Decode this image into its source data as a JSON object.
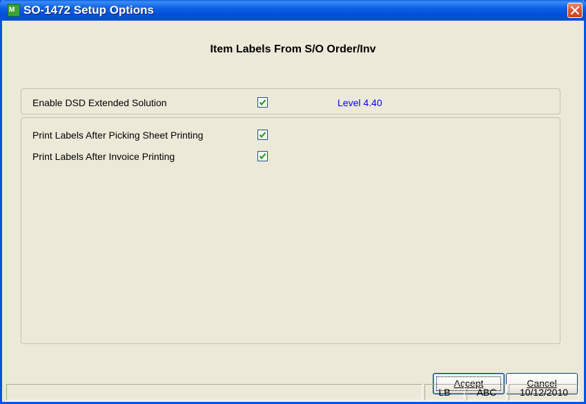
{
  "window": {
    "title": "SO-1472 Setup Options",
    "app_icon_text": "M"
  },
  "heading": "Item Labels From S/O Order/Inv",
  "options": {
    "enable_dsd": {
      "label": "Enable DSD Extended Solution",
      "checked": true
    },
    "level": "Level  4.40",
    "print_after_picking": {
      "label": "Print Labels After Picking Sheet Printing",
      "checked": true
    },
    "print_after_invoice": {
      "label": "Print Labels After Invoice Printing",
      "checked": true
    }
  },
  "buttons": {
    "accept": "Accept",
    "cancel": "Cancel"
  },
  "statusbar": {
    "main": "",
    "user": "LB",
    "company": "ABC",
    "date": "10/12/2010"
  },
  "colors": {
    "titlebar": "#0054e3",
    "level_text": "#0000ff",
    "checkmark": "#21a121"
  }
}
